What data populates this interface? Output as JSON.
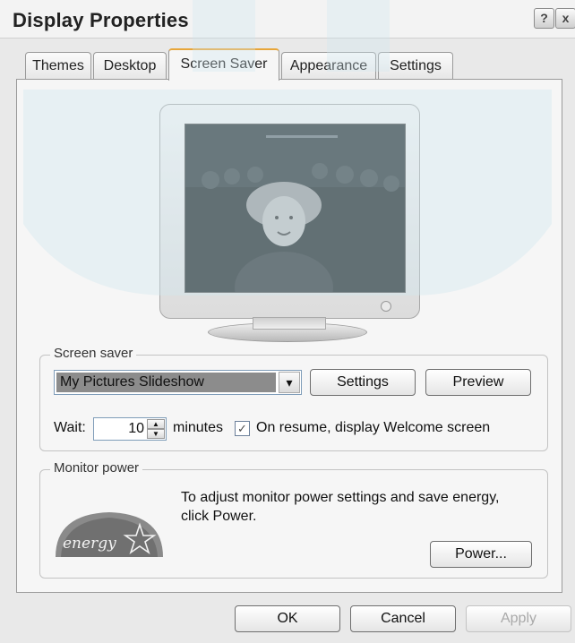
{
  "window": {
    "title": "Display Properties",
    "help_glyph": "?",
    "close_glyph": "x"
  },
  "tabs": [
    {
      "label": "Themes",
      "active": false
    },
    {
      "label": "Desktop",
      "active": false
    },
    {
      "label": "Screen Saver",
      "active": true
    },
    {
      "label": "Appearance",
      "active": false
    },
    {
      "label": "Settings",
      "active": false
    }
  ],
  "screen_saver": {
    "group_label": "Screen saver",
    "selected": "My Pictures Slideshow",
    "dropdown_glyph": "▾",
    "settings_button": "Settings",
    "preview_button": "Preview",
    "wait_label": "Wait:",
    "wait_value": "10",
    "minutes_label": "minutes",
    "resume_checked": true,
    "check_glyph": "✓",
    "resume_label": "On resume, display Welcome screen"
  },
  "monitor_power": {
    "group_label": "Monitor power",
    "description": "To adjust monitor power settings and save energy, click Power.",
    "power_button": "Power...",
    "logo_text": "energy"
  },
  "footer": {
    "ok": "OK",
    "cancel": "Cancel",
    "apply": "Apply"
  },
  "colors": {
    "watermark": "#cfe6ee",
    "active_tab_accent": "#e8a63a",
    "selection_bg": "#8c8c8c"
  }
}
